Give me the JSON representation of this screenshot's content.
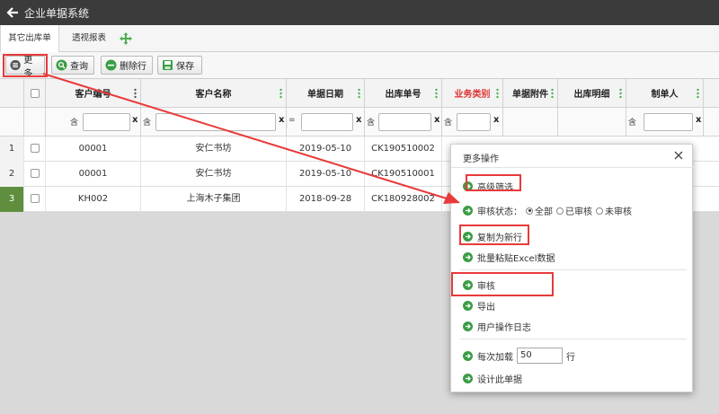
{
  "app": {
    "title": "企业单据系统"
  },
  "tabs": [
    {
      "label": "其它出库单",
      "active": true
    },
    {
      "label": "透视报表",
      "active": false
    }
  ],
  "toolbar": {
    "more_label": "更多",
    "query_label": "查询",
    "delete_row_label": "删除行",
    "save_label": "保存"
  },
  "table": {
    "columns": [
      "客户编号",
      "客户名称",
      "单据日期",
      "出库单号",
      "业务类别",
      "单据附件",
      "出库明细",
      "制单人"
    ],
    "filter_contains": "含",
    "filter_equals": "=",
    "filter_clear": "x",
    "rows": [
      {
        "num": "1",
        "cust_code": "00001",
        "cust_name": "安仁书坊",
        "date": "2019-05-10",
        "order_no": "CK190510002"
      },
      {
        "num": "2",
        "cust_code": "00001",
        "cust_name": "安仁书坊",
        "date": "2019-05-10",
        "order_no": "CK190510001"
      },
      {
        "num": "3",
        "cust_code": "KH002",
        "cust_name": "上海木子集团",
        "date": "2018-09-28",
        "order_no": "CK180928002"
      }
    ]
  },
  "dialog": {
    "title": "更多操作",
    "advanced_filter": "高级筛选",
    "audit_status_label": "审核状态：",
    "audit_options": [
      {
        "label": "全部",
        "selected": true
      },
      {
        "label": "已审核",
        "selected": false
      },
      {
        "label": "未审核",
        "selected": false
      }
    ],
    "copy_new_row": "复制为新行",
    "batch_paste": "批量粘贴Excel数据",
    "audit": "审核",
    "export": "导出",
    "user_log": "用户操作日志",
    "load_prefix": "每次加载",
    "load_value": "50",
    "load_suffix": "行",
    "design_doc": "设计此单据"
  },
  "colors": {
    "accent_green": "#4caf50",
    "highlight_red": "#e83a3a",
    "titlebar": "#3b3b3b",
    "selected_row": "#5f8f3e"
  }
}
